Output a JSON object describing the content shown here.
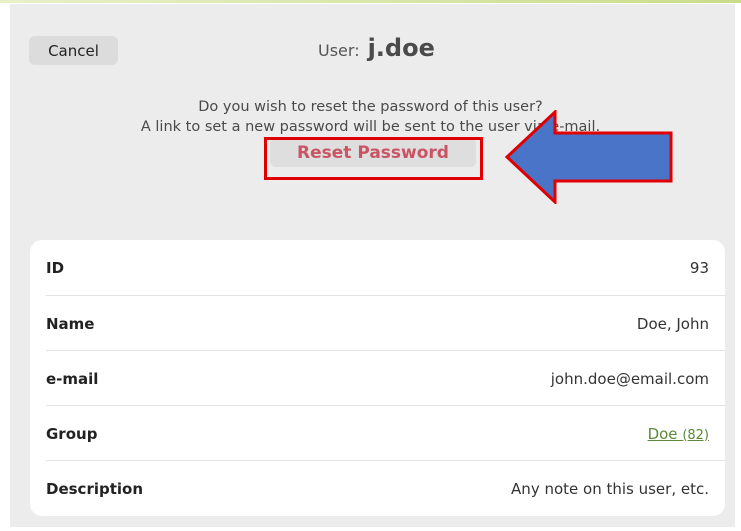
{
  "header": {
    "cancel_label": "Cancel",
    "user_label": "User:",
    "username": "j.doe"
  },
  "reset": {
    "question": "Do you wish to reset the password of this user?",
    "info": "A link to set a new password will be sent to the user via e-mail.",
    "button_label": "Reset Password"
  },
  "annotation": {
    "box_color": "#e00000",
    "arrow_color": "#4a74c8"
  },
  "details": {
    "rows": [
      {
        "label": "ID",
        "value": "93"
      },
      {
        "label": "Name",
        "value": "Doe, John"
      },
      {
        "label": "e-mail",
        "value": "john.doe@email.com"
      },
      {
        "label": "Group",
        "value": "Doe",
        "extra": "(82)"
      },
      {
        "label": "Description",
        "value": "Any note on this user, etc."
      }
    ]
  },
  "colors": {
    "panel": "#ececec",
    "reset_text": "#c95464",
    "link": "#5a8a3a"
  }
}
